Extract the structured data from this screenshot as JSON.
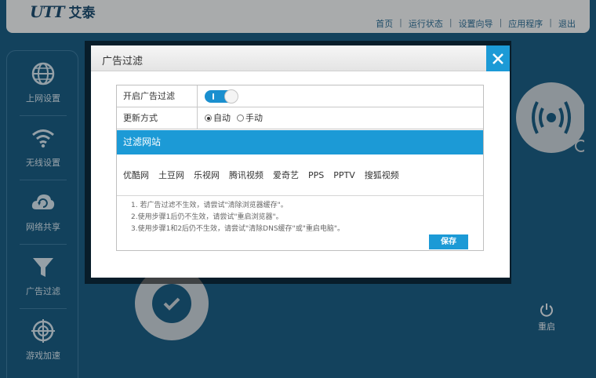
{
  "app": {
    "logo_mark": "UTT",
    "logo_name": "艾泰"
  },
  "topnav": [
    "首页",
    "运行状态",
    "设置向导",
    "应用程序",
    "退出"
  ],
  "sidebar": {
    "items": [
      {
        "label": "上网设置",
        "icon": "globe-icon"
      },
      {
        "label": "无线设置",
        "icon": "wifi-icon"
      },
      {
        "label": "网络共享",
        "icon": "cloud-sync-icon"
      },
      {
        "label": "广告过滤",
        "icon": "funnel-icon"
      },
      {
        "label": "游戏加速",
        "icon": "crosshair-icon"
      }
    ]
  },
  "background": {
    "reboot_label": "重启"
  },
  "modal": {
    "title": "广告过滤",
    "enable_label": "开启广告过滤",
    "enable_on": true,
    "update_label": "更新方式",
    "update_options": [
      {
        "label": "自动",
        "selected": true
      },
      {
        "label": "手动",
        "selected": false
      }
    ],
    "section_title": "过滤网站",
    "sites": [
      "优酷网",
      "土豆网",
      "乐视网",
      "腾讯视频",
      "爱奇艺",
      "PPS",
      "PPTV",
      "搜狐视频"
    ],
    "notes": [
      "1. 若广告过滤不生效，请尝试\"清除浏览器缓存\"。",
      "2.使用步骤1后仍不生效，请尝试\"重启浏览器\"。",
      "3.使用步骤1和2后仍不生效，请尝试\"清除DNS缓存\"或\"重启电脑\"。"
    ],
    "save_label": "保存"
  },
  "colors": {
    "accent": "#1c9ad6",
    "background": "#1c5f86"
  }
}
